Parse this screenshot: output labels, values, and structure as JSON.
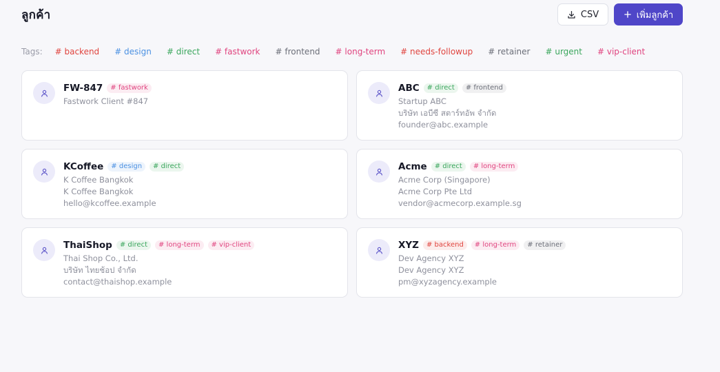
{
  "header": {
    "title": "ลูกค้า",
    "csv_label": "CSV",
    "add_label": "เพิ่มลูกค้า"
  },
  "colors": {
    "accent": "#4f46c8",
    "backend": "#e0443e",
    "design": "#4a90e2",
    "direct": "#3aa65c",
    "fastwork": "#e0447f",
    "frontend": "#6b6e78",
    "long-term": "#e0447f",
    "needs-followup": "#e0443e",
    "retainer": "#6b6e78",
    "urgent": "#3aa65c",
    "vip-client": "#e0447f"
  },
  "tagbar": {
    "label": "Tags:",
    "tags": [
      {
        "text": "# backend",
        "key": "backend"
      },
      {
        "text": "# design",
        "key": "design"
      },
      {
        "text": "# direct",
        "key": "direct"
      },
      {
        "text": "# fastwork",
        "key": "fastwork"
      },
      {
        "text": "# frontend",
        "key": "frontend"
      },
      {
        "text": "# long-term",
        "key": "long-term"
      },
      {
        "text": "# needs-followup",
        "key": "needs-followup"
      },
      {
        "text": "# retainer",
        "key": "retainer"
      },
      {
        "text": "# urgent",
        "key": "urgent"
      },
      {
        "text": "# vip-client",
        "key": "vip-client"
      }
    ]
  },
  "clients": [
    {
      "name": "FW-847",
      "tags": [
        {
          "text": "# fastwork",
          "key": "fastwork"
        }
      ],
      "lines": [
        "Fastwork Client #847"
      ]
    },
    {
      "name": "ABC",
      "tags": [
        {
          "text": "# direct",
          "key": "direct"
        },
        {
          "text": "# frontend",
          "key": "frontend"
        }
      ],
      "lines": [
        "Startup ABC",
        "บริษัท เอบีซี สตาร์ทอัพ จำกัด",
        "founder@abc.example"
      ]
    },
    {
      "name": "KCoffee",
      "tags": [
        {
          "text": "# design",
          "key": "design"
        },
        {
          "text": "# direct",
          "key": "direct"
        }
      ],
      "lines": [
        "K Coffee Bangkok",
        "K Coffee Bangkok",
        "hello@kcoffee.example"
      ]
    },
    {
      "name": "Acme",
      "tags": [
        {
          "text": "# direct",
          "key": "direct"
        },
        {
          "text": "# long-term",
          "key": "long-term"
        }
      ],
      "lines": [
        "Acme Corp (Singapore)",
        "Acme Corp Pte Ltd",
        "vendor@acmecorp.example.sg"
      ]
    },
    {
      "name": "ThaiShop",
      "tags": [
        {
          "text": "# direct",
          "key": "direct"
        },
        {
          "text": "# long-term",
          "key": "long-term"
        },
        {
          "text": "# vip-client",
          "key": "vip-client"
        }
      ],
      "lines": [
        "Thai Shop Co., Ltd.",
        "บริษัท ไทยช้อป จำกัด",
        "contact@thaishop.example"
      ]
    },
    {
      "name": "XYZ",
      "tags": [
        {
          "text": "# backend",
          "key": "backend"
        },
        {
          "text": "# long-term",
          "key": "long-term"
        },
        {
          "text": "# retainer",
          "key": "retainer"
        }
      ],
      "lines": [
        "Dev Agency XYZ",
        "Dev Agency XYZ",
        "pm@xyzagency.example"
      ]
    }
  ]
}
